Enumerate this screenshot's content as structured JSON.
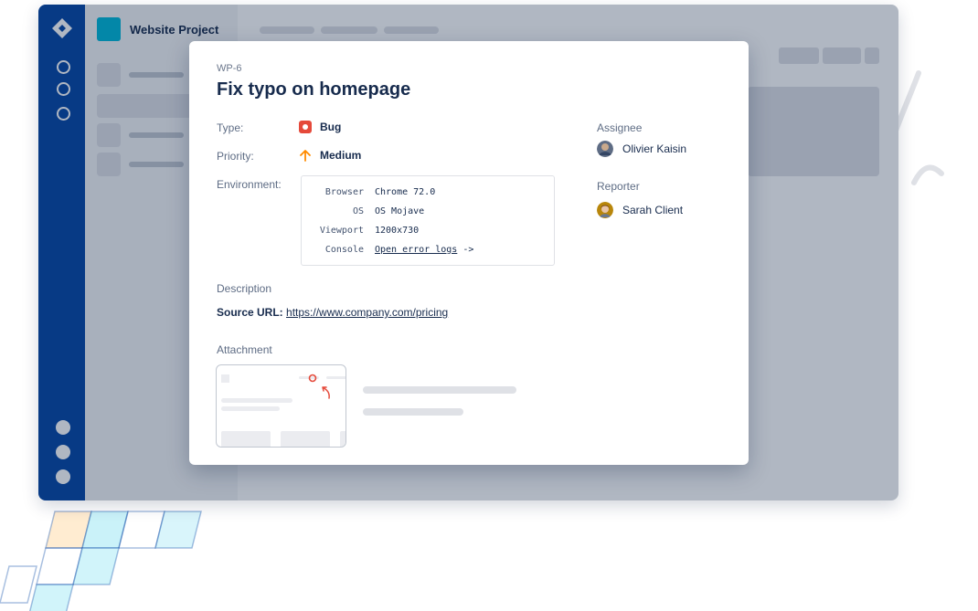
{
  "project": {
    "name": "Website Project"
  },
  "issue": {
    "key": "WP-6",
    "title": "Fix typo on homepage",
    "fields": {
      "type_label": "Type:",
      "type_value": "Bug",
      "priority_label": "Priority:",
      "priority_value": "Medium",
      "environment_label": "Environment:"
    },
    "environment": [
      {
        "key": "Browser",
        "value": "Chrome 72.0"
      },
      {
        "key": "OS",
        "value": "OS Mojave"
      },
      {
        "key": "Viewport",
        "value": "1200x730"
      },
      {
        "key": "Console",
        "value": "Open error logs",
        "suffix": " ->"
      }
    ],
    "assignee_label": "Assignee",
    "assignee_name": "Olivier Kaisin",
    "reporter_label": "Reporter",
    "reporter_name": "Sarah Client",
    "description_label": "Description",
    "source_url_label": "Source URL:",
    "source_url": "https://www.company.com/pricing",
    "attachment_label": "Attachment"
  },
  "icons": {
    "logo": "jira-logo-icon",
    "type": "bug-icon",
    "priority": "arrow-up-icon"
  },
  "colors": {
    "nav": "#0747a6",
    "project_avatar": "#00b8d9",
    "bug": "#e5493a",
    "priority_medium": "#ff8b00",
    "overlay": "#091e42"
  }
}
